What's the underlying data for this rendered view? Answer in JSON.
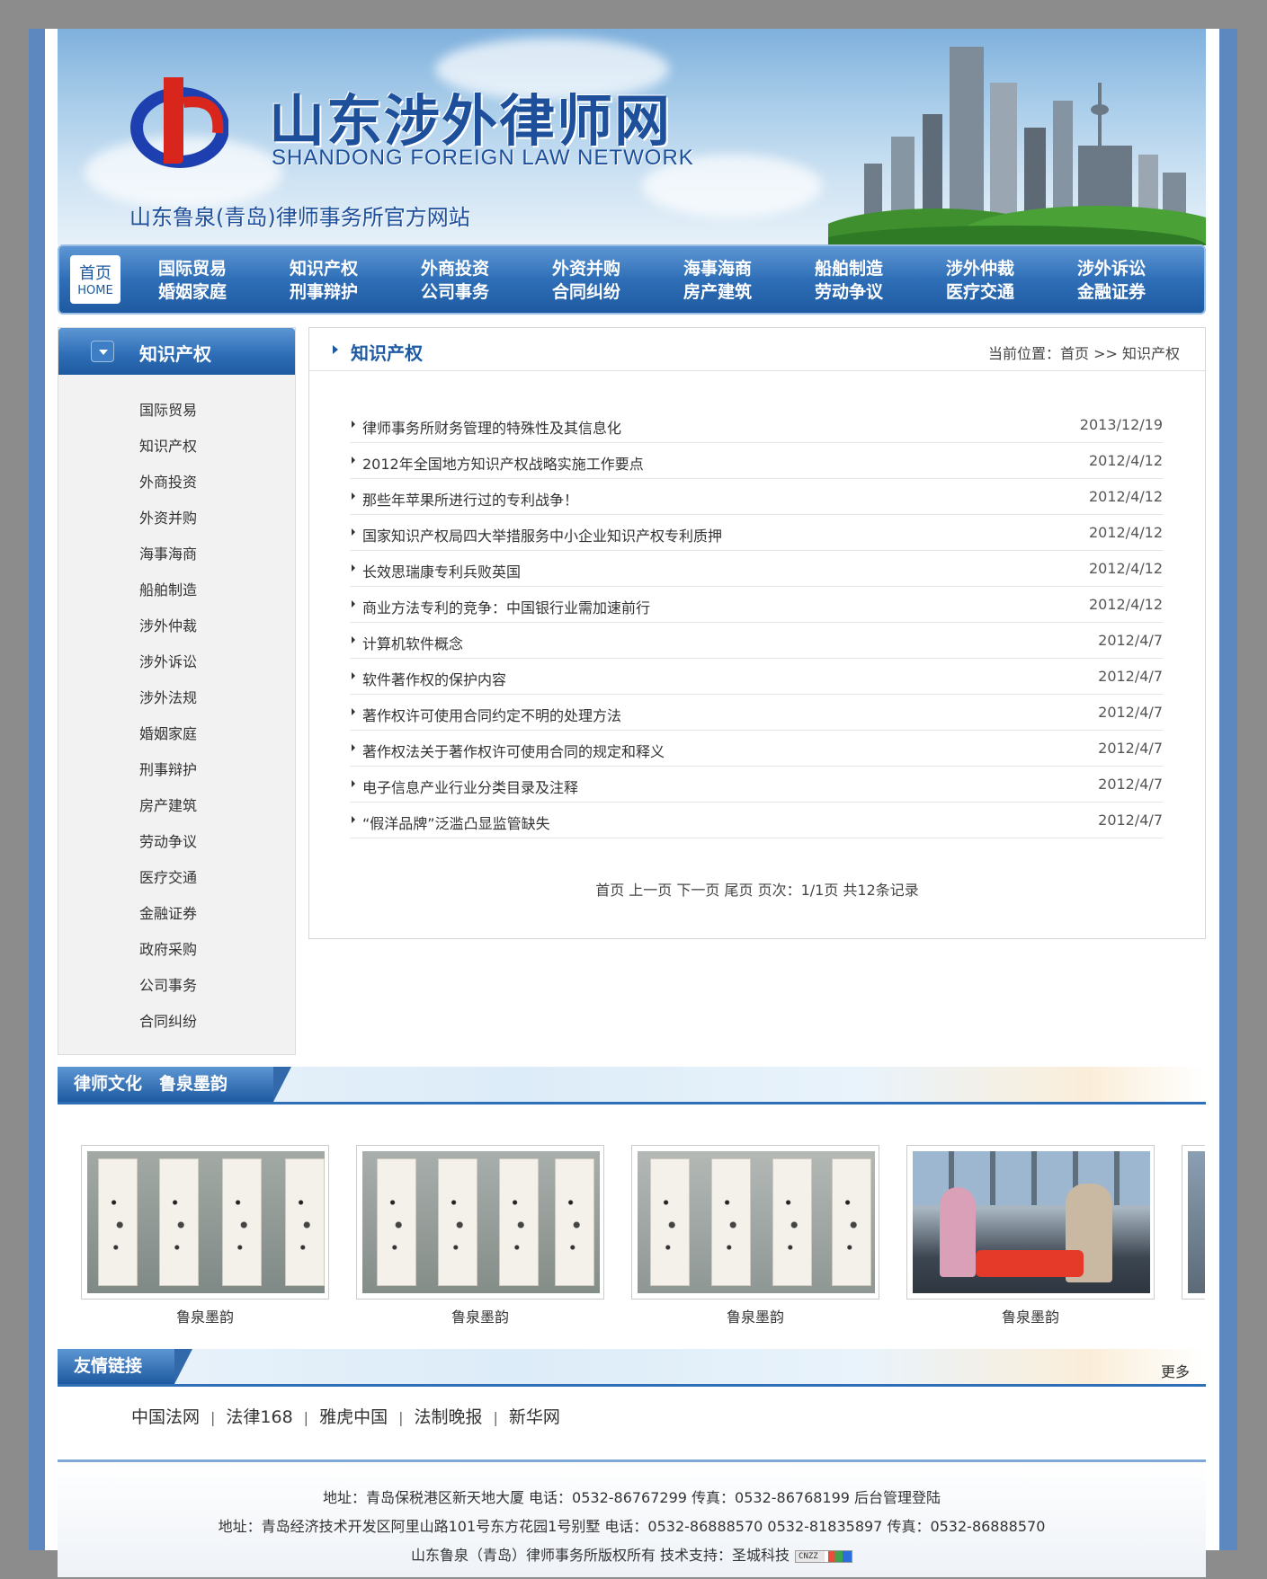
{
  "site": {
    "title": "山东涉外律师网",
    "title_en": "SHANDONG FOREIGN LAW NETWORK",
    "subtitle": "山东鲁泉(青岛)律师事务所官方网站"
  },
  "nav": {
    "home_zh": "首页",
    "home_en": "HOME",
    "items": [
      {
        "line1": "国际贸易",
        "line2": "婚姻家庭"
      },
      {
        "line1": "知识产权",
        "line2": "刑事辩护"
      },
      {
        "line1": "外商投资",
        "line2": "公司事务"
      },
      {
        "line1": "外资并购",
        "line2": "合同纠纷"
      },
      {
        "line1": "海事海商",
        "line2": "房产建筑"
      },
      {
        "line1": "船舶制造",
        "line2": "劳动争议"
      },
      {
        "line1": "涉外仲裁",
        "line2": "医疗交通"
      },
      {
        "line1": "涉外诉讼",
        "line2": "金融证券"
      }
    ]
  },
  "sidebar": {
    "title": "知识产权",
    "items": [
      "国际贸易",
      "知识产权",
      "外商投资",
      "外资并购",
      "海事海商",
      "船舶制造",
      "涉外仲裁",
      "涉外诉讼",
      "涉外法规",
      "婚姻家庭",
      "刑事辩护",
      "房产建筑",
      "劳动争议",
      "医疗交通",
      "金融证券",
      "政府采购",
      "公司事务",
      "合同纠纷"
    ]
  },
  "main": {
    "title": "知识产权",
    "location": "当前位置：首页 >> 知识产权",
    "articles": [
      {
        "title": "律师事务所财务管理的特殊性及其信息化",
        "date": "2013/12/19"
      },
      {
        "title": "2012年全国地方知识产权战略实施工作要点",
        "date": "2012/4/12"
      },
      {
        "title": "那些年苹果所进行过的专利战争！",
        "date": "2012/4/12"
      },
      {
        "title": "国家知识产权局四大举措服务中小企业知识产权专利质押",
        "date": "2012/4/12"
      },
      {
        "title": "长效思瑞康专利兵败英国",
        "date": "2012/4/12"
      },
      {
        "title": "商业方法专利的竞争：中国银行业需加速前行",
        "date": "2012/4/12"
      },
      {
        "title": "计算机软件概念",
        "date": "2012/4/7"
      },
      {
        "title": "软件著作权的保护内容",
        "date": "2012/4/7"
      },
      {
        "title": "著作权许可使用合同约定不明的处理方法",
        "date": "2012/4/7"
      },
      {
        "title": "著作权法关于著作权许可使用合同的规定和释义",
        "date": "2012/4/7"
      },
      {
        "title": "电子信息产业行业分类目录及注释",
        "date": "2012/4/7"
      },
      {
        "title": "“假洋品牌”泛滥凸显监管缺失",
        "date": "2012/4/7"
      }
    ],
    "pager": "首页 上一页 下一页 尾页 页次：1/1页 共12条记录"
  },
  "culture": {
    "title": "律师文化　鲁泉墨韵",
    "items": [
      {
        "caption": "鲁泉墨韵"
      },
      {
        "caption": "鲁泉墨韵"
      },
      {
        "caption": "鲁泉墨韵"
      },
      {
        "caption": "鲁泉墨韵"
      }
    ]
  },
  "links": {
    "title": "友情链接",
    "more": "更多",
    "items": [
      "中国法网",
      "法律168",
      "雅虎中国",
      "法制晚报",
      "新华网"
    ],
    "separator": "|"
  },
  "footer": {
    "line1": "地址：青岛保税港区新天地大厦 电话：0532-86767299 传真：0532-86768199 后台管理登陆",
    "line2": "地址：青岛经济技术开发区阿里山路101号东方花园1号别墅 电话：0532-86888570 0532-81835897 传真：0532-86888570",
    "line3": "山东鲁泉（青岛）律师事务所版权所有 技术支持：圣城科技",
    "badge": "CNZZ"
  },
  "colors": {
    "primary": "#1e5aa1",
    "accent_red": "#d9261c",
    "frame": "#5d87bf"
  }
}
